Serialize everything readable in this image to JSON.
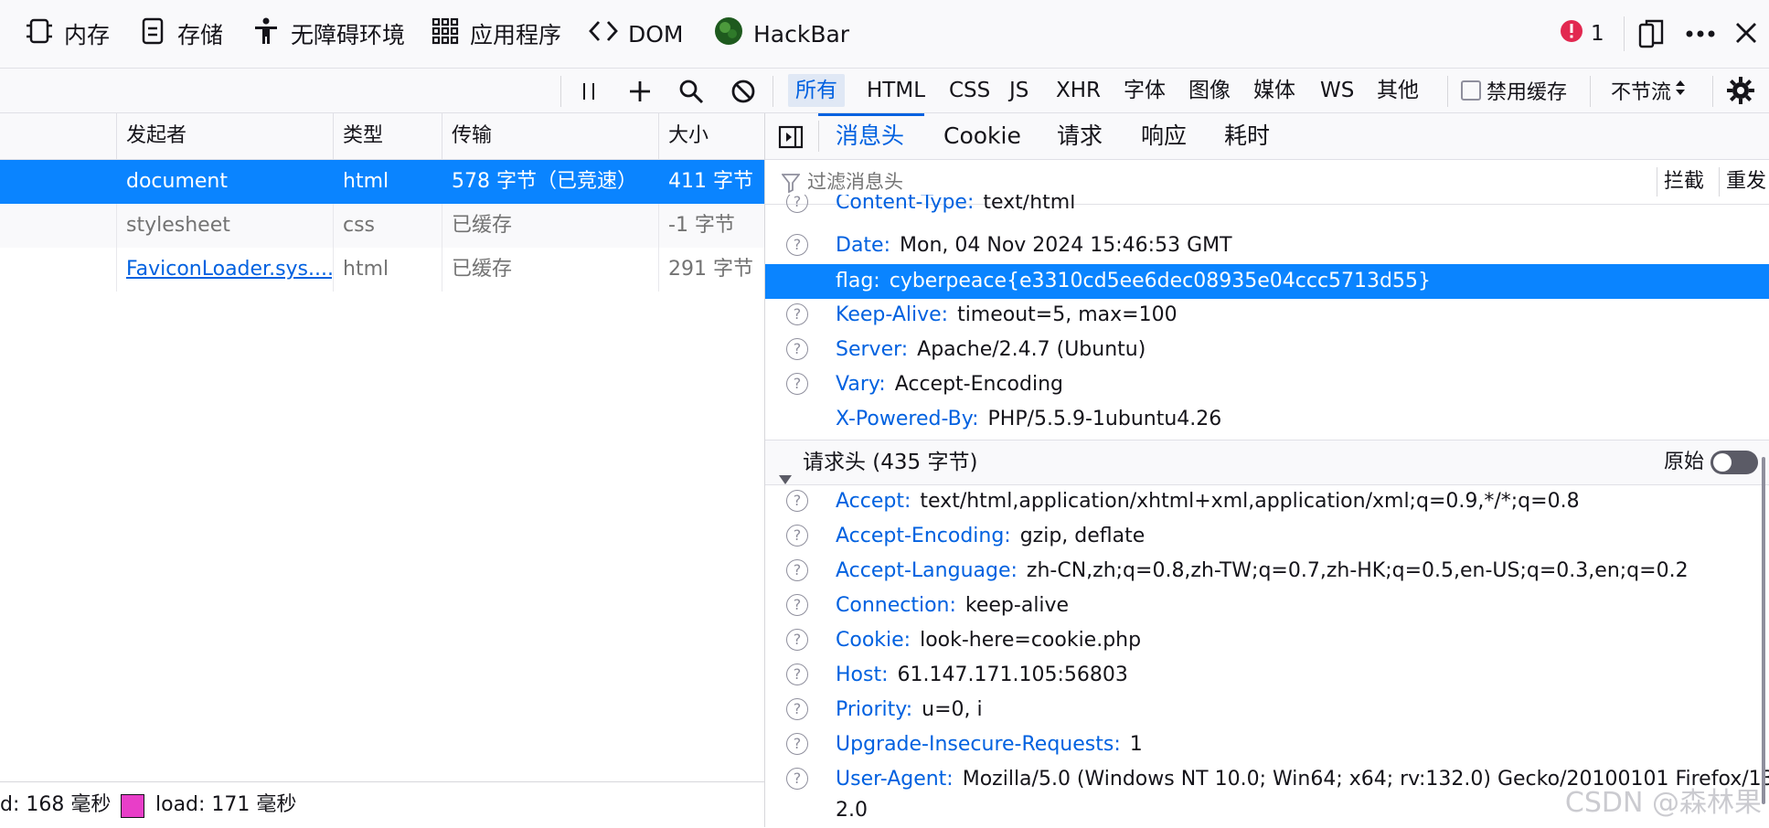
{
  "topbar": {
    "tabs": [
      {
        "label": "内存",
        "icon": "memory-chip-icon"
      },
      {
        "label": "存储",
        "icon": "storage-icon"
      },
      {
        "label": "无障碍环境",
        "icon": "accessibility-icon"
      },
      {
        "label": "应用程序",
        "icon": "grid-apps-icon"
      },
      {
        "label": "DOM",
        "icon": "code-brackets-icon"
      },
      {
        "label": "HackBar",
        "icon": "hackbar-logo-icon"
      }
    ],
    "error_count": "1"
  },
  "toolbar": {
    "filters": [
      "所有",
      "HTML",
      "CSS",
      "JS",
      "XHR",
      "字体",
      "图像",
      "媒体",
      "WS",
      "其他"
    ],
    "disable_cache_label": "禁用缓存",
    "throttle_label": "不节流"
  },
  "request_list": {
    "columns": [
      "发起者",
      "类型",
      "传输",
      "大小"
    ],
    "rows": [
      {
        "initiator": "document",
        "type": "html",
        "transfer": "578 字节（已竞速）",
        "size": "411 字节"
      },
      {
        "initiator": "stylesheet",
        "type": "css",
        "transfer": "已缓存",
        "size": "-1 字节"
      },
      {
        "initiator": "FaviconLoader.sys....",
        "type": "html",
        "transfer": "已缓存",
        "size": "291 字节"
      }
    ]
  },
  "statusbar": {
    "domcontent": "d: 168 毫秒",
    "load": "load: 171 毫秒",
    "load_color": "#e83ec8"
  },
  "details": {
    "tabs": [
      "消息头",
      "Cookie",
      "请求",
      "响应",
      "耗时"
    ],
    "filter_placeholder": "过滤消息头",
    "block_label": "拦截",
    "resend_label": "重发",
    "response_headers": [
      {
        "key": "Content-Type:",
        "value": "text/html"
      },
      {
        "key": "Date:",
        "value": "Mon, 04 Nov 2024 15:46:53 GMT"
      },
      {
        "key": "flag:",
        "value": "cyberpeace{e3310cd5ee6dec08935e04ccc5713d55}"
      },
      {
        "key": "Keep-Alive:",
        "value": "timeout=5, max=100"
      },
      {
        "key": "Server:",
        "value": "Apache/2.4.7 (Ubuntu)"
      },
      {
        "key": "Vary:",
        "value": "Accept-Encoding"
      },
      {
        "key": "X-Powered-By:",
        "value": "PHP/5.5.9-1ubuntu4.26"
      }
    ],
    "request_section_title": "请求头 (435 字节)",
    "raw_label": "原始",
    "request_headers": [
      {
        "key": "Accept:",
        "value": "text/html,application/xhtml+xml,application/xml;q=0.9,*/*;q=0.8"
      },
      {
        "key": "Accept-Encoding:",
        "value": "gzip, deflate"
      },
      {
        "key": "Accept-Language:",
        "value": "zh-CN,zh;q=0.8,zh-TW;q=0.7,zh-HK;q=0.5,en-US;q=0.3,en;q=0.2"
      },
      {
        "key": "Connection:",
        "value": "keep-alive"
      },
      {
        "key": "Cookie:",
        "value": "look-here=cookie.php"
      },
      {
        "key": "Host:",
        "value": "61.147.171.105:56803"
      },
      {
        "key": "Priority:",
        "value": "u=0, i"
      },
      {
        "key": "Upgrade-Insecure-Requests:",
        "value": "1"
      },
      {
        "key": "User-Agent:",
        "value": "Mozilla/5.0 (Windows NT 10.0; Win64; x64; rv:132.0) Gecko/20100101 Firefox/13"
      }
    ],
    "ua_wrap": "2.0"
  },
  "watermark": "CSDN @森林果",
  "colors": {
    "accent": "#0061e0",
    "selection": "#0a84ff",
    "error": "#e22850"
  }
}
